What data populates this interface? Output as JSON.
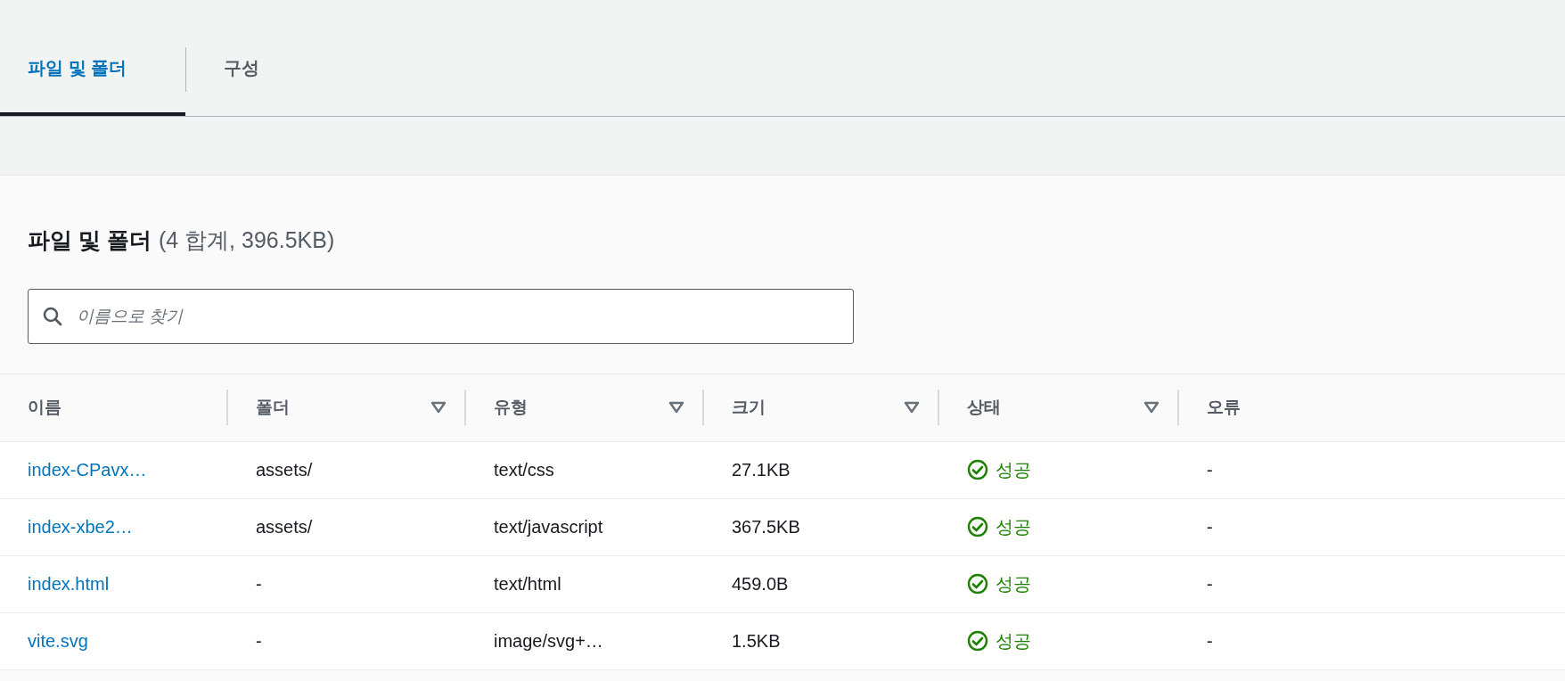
{
  "tabs": [
    {
      "label": "파일 및 폴더",
      "selected": true
    },
    {
      "label": "구성",
      "selected": false
    }
  ],
  "section": {
    "title": "파일 및 폴더",
    "summary": "(4 합계, 396.5KB)"
  },
  "search": {
    "placeholder": "이름으로 찾기"
  },
  "table": {
    "columns": [
      {
        "label": "이름",
        "sortable": false
      },
      {
        "label": "폴더",
        "sortable": true
      },
      {
        "label": "유형",
        "sortable": true
      },
      {
        "label": "크기",
        "sortable": true
      },
      {
        "label": "상태",
        "sortable": true
      },
      {
        "label": "오류",
        "sortable": false
      }
    ],
    "rows": [
      {
        "name": "index-CPavx…",
        "folder": "assets/",
        "type": "text/css",
        "size": "27.1KB",
        "status": {
          "kind": "success",
          "label": "성공"
        },
        "error": "-"
      },
      {
        "name": "index-xbe2…",
        "folder": "assets/",
        "type": "text/javascript",
        "size": "367.5KB",
        "status": {
          "kind": "success",
          "label": "성공"
        },
        "error": "-"
      },
      {
        "name": "index.html",
        "folder": "-",
        "type": "text/html",
        "size": "459.0B",
        "status": {
          "kind": "success",
          "label": "성공"
        },
        "error": "-"
      },
      {
        "name": "vite.svg",
        "folder": "-",
        "type": "image/svg+…",
        "size": "1.5KB",
        "status": {
          "kind": "success",
          "label": "성공"
        },
        "error": "-"
      }
    ]
  }
}
